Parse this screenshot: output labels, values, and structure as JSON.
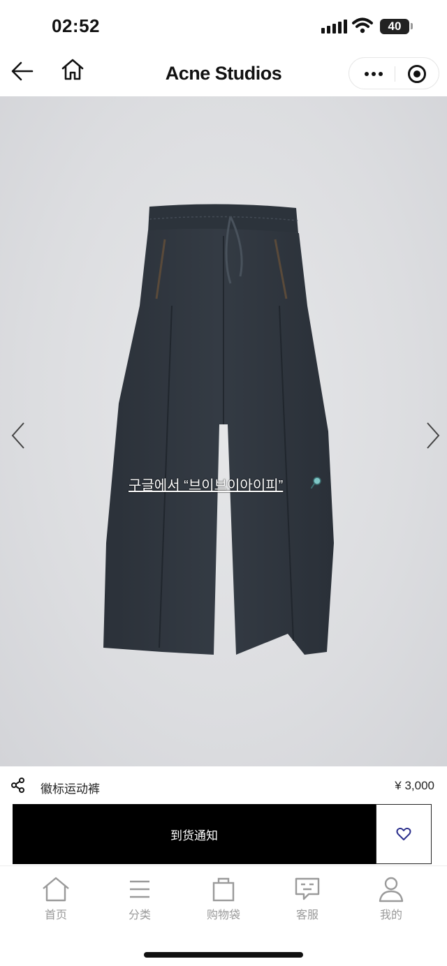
{
  "status_bar": {
    "time": "02:52",
    "battery": "40"
  },
  "nav": {
    "brand": "Acne Studios",
    "icons": [
      "back-arrow-icon",
      "home-icon",
      "more-icon",
      "close-mini-program-icon"
    ]
  },
  "product_image": {
    "overlay_text": "구글에서 “브이브이아이피”"
  },
  "product": {
    "name": "徽标运动裤",
    "price": "¥ 3,000"
  },
  "actions": {
    "notify_label": "到货通知"
  },
  "tabs": [
    {
      "label": "首页",
      "icon": "home-icon"
    },
    {
      "label": "分类",
      "icon": "menu-icon"
    },
    {
      "label": "购物袋",
      "icon": "bag-icon"
    },
    {
      "label": "客服",
      "icon": "chat-icon"
    },
    {
      "label": "我的",
      "icon": "user-icon"
    }
  ],
  "colors": {
    "primary_button": "#000000",
    "heart": "#2b2f8c",
    "tab_inactive": "#9a9a9a",
    "pants": "#2a3038"
  }
}
